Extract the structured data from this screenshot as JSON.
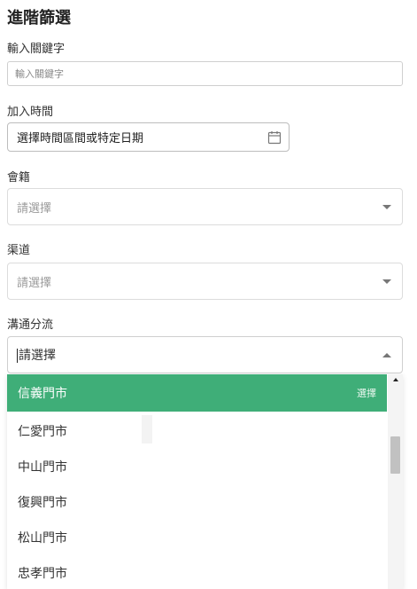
{
  "page": {
    "title": "進階篩選"
  },
  "keyword": {
    "label": "輸入關鍵字",
    "placeholder": "輸入關鍵字"
  },
  "join_time": {
    "label": "加入時間",
    "value": "選擇時間區間或特定日期",
    "icon": "calendar-icon"
  },
  "membership": {
    "label": "會籍",
    "value": "請選擇",
    "icon": "chevron-down-icon"
  },
  "channel": {
    "label": "渠道",
    "value": "請選擇",
    "icon": "chevron-down-icon"
  },
  "segment": {
    "label": "溝通分流",
    "value": "請選擇",
    "icon": "chevron-up-icon"
  },
  "dropdown": {
    "selected_hint": "選擇",
    "highlight_color": "#3fae78",
    "options": [
      {
        "label": "信義門市"
      },
      {
        "label": "仁愛門市"
      },
      {
        "label": "中山門市"
      },
      {
        "label": "復興門市"
      },
      {
        "label": "松山門市"
      },
      {
        "label": "忠孝門市"
      }
    ]
  }
}
